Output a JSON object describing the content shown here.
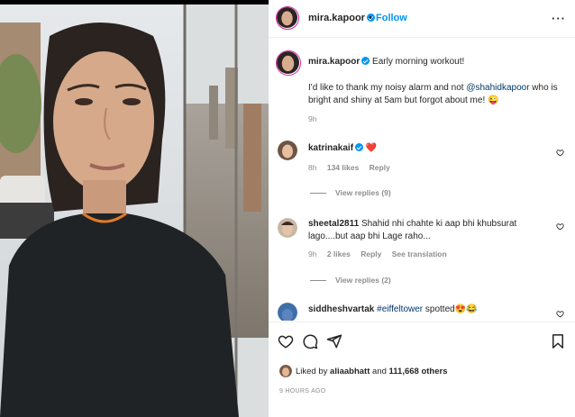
{
  "post": {
    "username": "mira.kapoor",
    "separator": "•",
    "follow_label": "Follow",
    "more_label": "···"
  },
  "caption": {
    "username": "mira.kapoor",
    "headline": "Early morning workout!",
    "body_before": "I'd like to thank my noisy alarm and not ",
    "mention": "@shahidkapoor",
    "body_after": " who is bright and shiny at 5am but forgot about me! 😜",
    "time": "9h"
  },
  "comments": [
    {
      "username": "katrinakaif",
      "verified": true,
      "text": "❤️",
      "time": "8h",
      "likes": "134 likes",
      "reply": "Reply",
      "view_replies": "View replies (9)"
    },
    {
      "username": "sheetal2811",
      "text": "Shahid nhi chahte ki aap bhi khubsurat lago....but aap bhi Lage raho...",
      "time": "9h",
      "likes": "2 likes",
      "reply": "Reply",
      "translation": "See translation",
      "view_replies": "View replies (2)"
    },
    {
      "username": "siddheshvartak",
      "mention": "#eiffeltower",
      "text": " spotted😍😂"
    }
  ],
  "likes": {
    "prefix": "Liked by ",
    "user": "aliaabhatt",
    "middle": " and ",
    "count": "111,668 others"
  },
  "post_time": "9 HOURS AGO",
  "icons": [
    "heart-icon",
    "comment-icon",
    "share-icon",
    "bookmark-icon",
    "more-icon",
    "verified-icon"
  ],
  "colors": {
    "link": "#0095f6",
    "mention": "#00376b",
    "meta": "#8e8e8e",
    "heart": "#ed4956"
  }
}
